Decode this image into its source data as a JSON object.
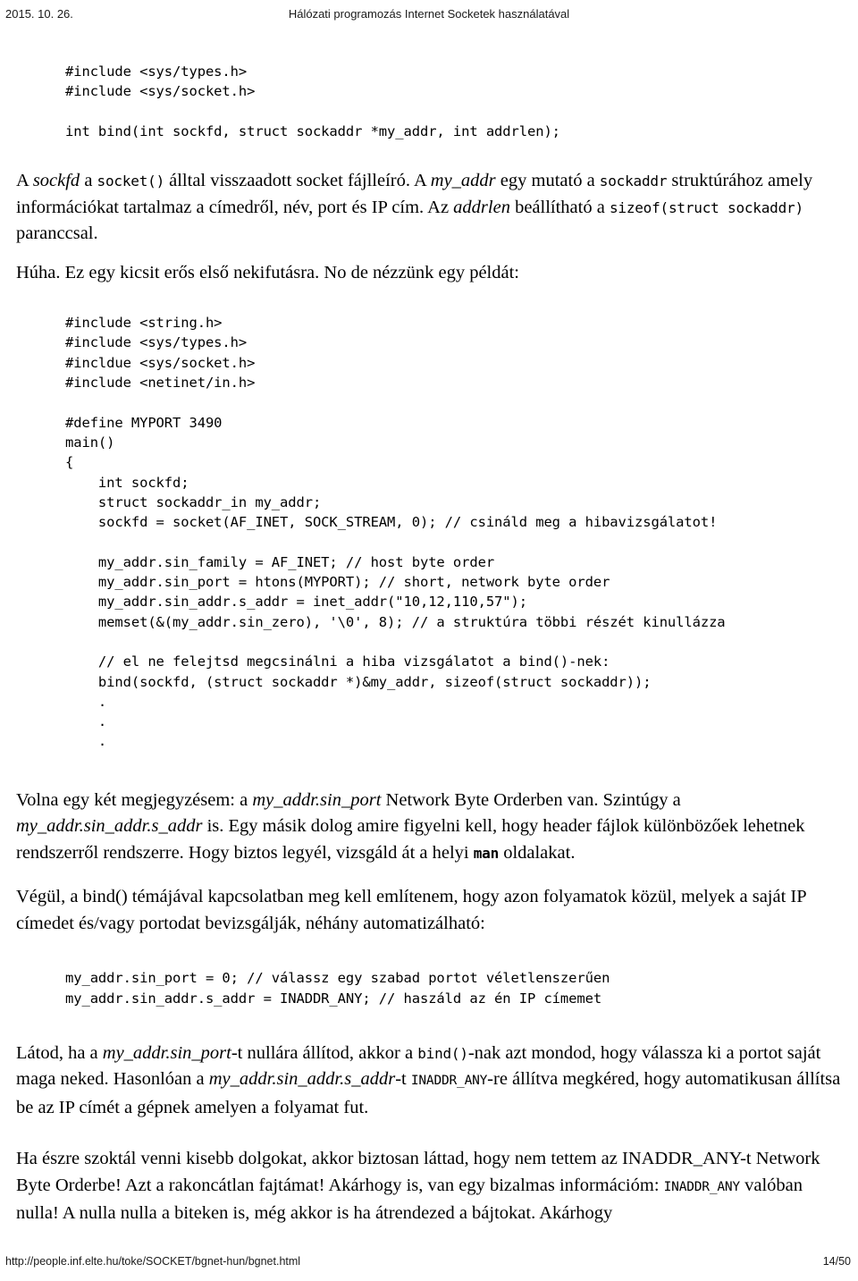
{
  "header": {
    "date": "2015. 10. 26.",
    "title": "Hálózati programozás Internet Socketek használatával"
  },
  "footer": {
    "url": "http://people.inf.elte.hu/toke/SOCKET/bgnet-hun/bgnet.html",
    "page": "14/50"
  },
  "code_blocks": {
    "bind_signature": "#include <sys/types.h>\n#include <sys/socket.h>\n\nint bind(int sockfd, struct sockaddr *my_addr, int addrlen);",
    "example_includes": "#include <string.h>\n#include <sys/types.h>\n#incldue <sys/socket.h>\n#include <netinet/in.h>\n\n#define MYPORT 3490",
    "example_main": "main()\n{\n    int sockfd;\n    struct sockaddr_in my_addr;\n    sockfd = socket(AF_INET, SOCK_STREAM, 0); // csináld meg a hibavizsgálatot!\n\n    my_addr.sin_family = AF_INET; // host byte order\n    my_addr.sin_port = htons(MYPORT); // short, network byte order\n    my_addr.sin_addr.s_addr = inet_addr(\"10,12,110,57\");\n    memset(&(my_addr.sin_zero), '\\0', 8); // a struktúra többi részét kinullázza\n\n    // el ne felejtsd megcsinálni a hiba vizsgálatot a bind()-nek:\n    bind(sockfd, (struct sockaddr *)&my_addr, sizeof(struct sockaddr));\n    .\n    .\n    .",
    "auto_assign": "my_addr.sin_port = 0; // válassz egy szabad portot véletlenszerűen\nmy_addr.sin_addr.s_addr = INADDR_ANY; // haszáld az én IP címemet"
  },
  "paragraphs": {
    "p1": {
      "s1": "A ",
      "v1": "sockfd",
      "s2": " a ",
      "c1": "socket()",
      "s3": " álltal visszaadott socket fájlleíró. A ",
      "v2": "my_addr",
      "s4": " egy mutató a ",
      "c2": "sockaddr",
      "s5": " struktúrához amely információkat tartalmaz a címedről, név, port és IP cím. Az ",
      "v3": "addrlen",
      "s6": " beállítható a ",
      "c3": "sizeof(struct sockaddr)",
      "s7": " paranccsal."
    },
    "p2": {
      "text": "Húha. Ez egy kicsit erős első nekifutásra. No de nézzünk egy példát:"
    },
    "p3": {
      "s1": "Volna egy két megjegyzésem: a ",
      "v1": "my_addr.sin_port",
      "s2": " Network Byte Orderben van. Szintúgy a ",
      "v2": "my_addr.sin_addr.s_addr",
      "s3": " is. Egy másik dolog amire figyelni kell, hogy header fájlok különbözőek lehetnek rendszerről rendszerre. Hogy biztos legyél, vizsgáld át a helyi ",
      "c1": "man",
      "s4": " oldalakat."
    },
    "p4": {
      "text": "Végül, a bind() témájával kapcsolatban meg kell említenem, hogy azon folyamatok közül, melyek a saját IP címedet és/vagy portodat bevizsgálják, néhány automatizálható:"
    },
    "p5": {
      "s1": "Látod, ha a ",
      "v1": "my_addr.sin_port",
      "s2": "-t nullára állítod, akkor a ",
      "c1": "bind()",
      "s3": "-nak azt mondod, hogy válassza ki a portot saját maga neked. Hasonlóan a ",
      "v2": "my_addr.sin_addr.s_addr",
      "s4": "-t ",
      "c2": "INADDR_ANY",
      "s5": "-re állítva megkéred, hogy automatikusan állítsa be az IP címét a gépnek amelyen a folyamat fut."
    },
    "p6": {
      "s1": "Ha észre szoktál venni kisebb dolgokat, akkor biztosan láttad, hogy nem tettem az INADDR_ANY-t Network Byte Orderbe! Azt a rakoncátlan fajtámat! Akárhogy is, van egy bizalmas információm: ",
      "c1": "INADDR_ANY",
      "s2": " valóban nulla! A nulla nulla a biteken is, még akkor is ha átrendezed a bájtokat. Akárhogy"
    }
  }
}
